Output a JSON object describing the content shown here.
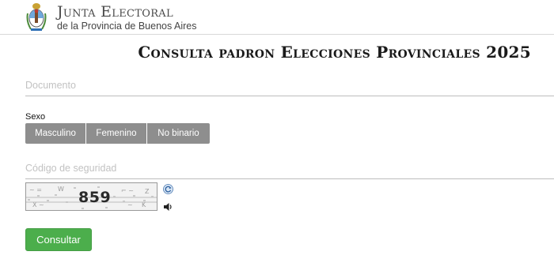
{
  "header": {
    "org_name": "Junta Electoral",
    "org_subtitle": "de la Provincia de Buenos Aires",
    "logo_icon": "province-coat-of-arms-icon"
  },
  "page": {
    "title": "Consulta padron Elecciones Provinciales 2025"
  },
  "form": {
    "documento_placeholder": "Documento",
    "documento_value": "",
    "sexo_label": "Sexo",
    "sexo_options": [
      "Masculino",
      "Femenino",
      "No binario"
    ],
    "sexo_selected": "",
    "codigo_placeholder": "Código de seguridad",
    "codigo_value": "",
    "captcha_text": "859",
    "refresh_icon": "refresh-icon",
    "audio_icon": "speaker-icon",
    "submit_label": "Consultar"
  },
  "colors": {
    "sexo_button_bg": "#8e8e8e",
    "submit_bg": "#4cae4c",
    "divider": "#d9d9d9"
  }
}
